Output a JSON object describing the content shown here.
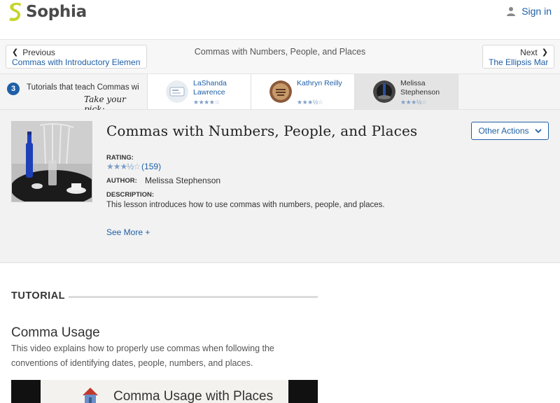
{
  "header": {
    "brand": "Sophia",
    "signin_label": "Sign in",
    "brand_color": "#c5d52d"
  },
  "nav": {
    "prev_label": "Previous",
    "prev_link": "Commas with Introductory Elements",
    "current_title": "Commas with Numbers, People, and Places",
    "next_label": "Next",
    "next_link": "The Ellipsis Mark"
  },
  "picker": {
    "count": "3",
    "label": "Tutorials that teach Commas wi",
    "hand_text": "Take your pick:",
    "tutors": [
      {
        "name": "LaShanda Lawrence",
        "stars": 4
      },
      {
        "name": "Kathryn Reilly",
        "stars": 3.5
      },
      {
        "name": "Melissa Stephenson",
        "stars": 3.5
      }
    ]
  },
  "lesson": {
    "title": "Commas with Numbers, People, and Places",
    "other_actions": "Other Actions",
    "rating_label": "RATING:",
    "rating_stars": 3.5,
    "rating_count": "(159)",
    "author_label": "AUTHOR:",
    "author": "Melissa Stephenson",
    "description_label": "DESCRIPTION:",
    "description": "This lesson introduces how to use commas with numbers, people, and places.",
    "see_more": "See More +"
  },
  "tutorial": {
    "heading": "TUTORIAL",
    "item_title": "Comma Usage",
    "item_description": "This video explains how to properly use commas when following the conventions of identifying dates, people, numbers, and places.",
    "video_caption": "Comma Usage with Places"
  }
}
